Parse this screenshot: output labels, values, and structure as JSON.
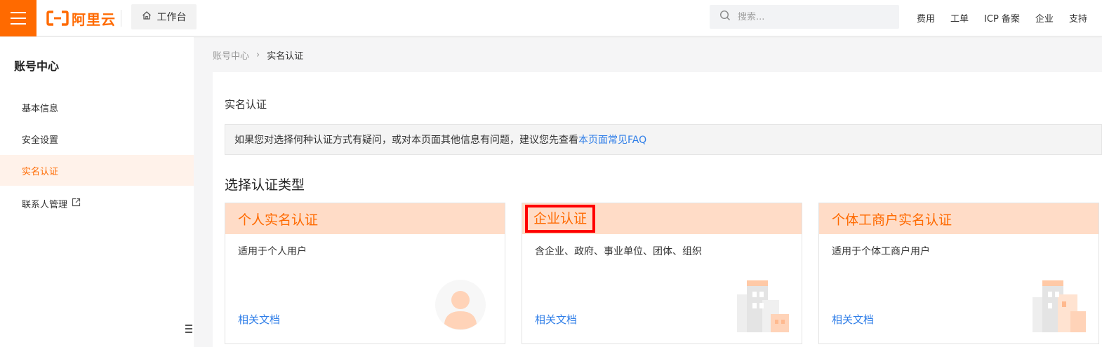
{
  "header": {
    "logo_text": "阿里云",
    "workbench_label": "工作台",
    "search_placeholder": "搜索...",
    "nav": [
      "费用",
      "工单",
      "ICP 备案",
      "企业",
      "支持"
    ]
  },
  "sidebar": {
    "title": "账号中心",
    "items": [
      {
        "label": "基本信息"
      },
      {
        "label": "安全设置"
      },
      {
        "label": "实名认证"
      },
      {
        "label": "联系人管理"
      }
    ]
  },
  "breadcrumb": {
    "root": "账号中心",
    "sep": "›",
    "current": "实名认证"
  },
  "main": {
    "title": "实名认证",
    "notice_text": "如果您对选择何种认证方式有疑问，或对本页面其他信息有问题，建议您先查看",
    "notice_link": "本页面常见FAQ",
    "section_title": "选择认证类型",
    "cards": [
      {
        "title": "个人实名认证",
        "desc": "适用于个人用户",
        "link": "相关文档"
      },
      {
        "title": "企业认证",
        "desc": "含企业、政府、事业单位、团体、组织",
        "link": "相关文档"
      },
      {
        "title": "个体工商户实名认证",
        "desc": "适用于个体工商户用户",
        "link": "相关文档"
      }
    ]
  },
  "colors": {
    "brand": "#ff6a00",
    "link": "#2f7ee8",
    "card_header": "#ffdcc7",
    "highlight": "#ff0000"
  }
}
